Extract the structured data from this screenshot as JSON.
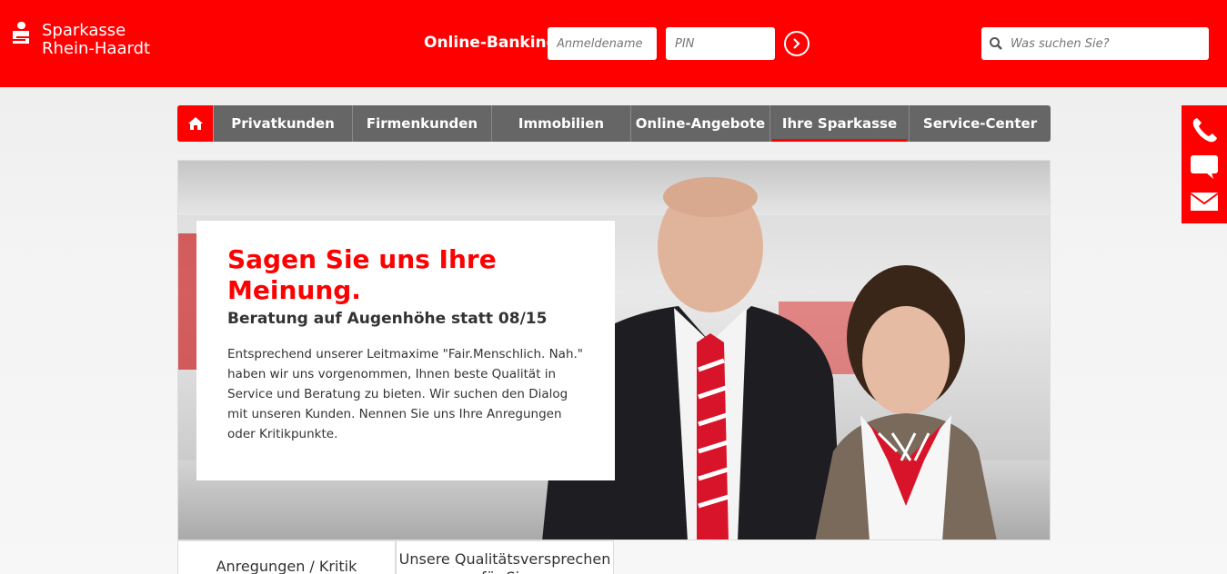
{
  "header": {
    "logo_line1": "Sparkasse",
    "logo_line2": "Rhein-Haardt",
    "online_banking_label": "Online-Banking",
    "username_placeholder": "Anmeldename",
    "pin_placeholder": "PIN",
    "search_placeholder": "Was suchen Sie?"
  },
  "nav": {
    "items": [
      {
        "label": "Privatkunden"
      },
      {
        "label": "Firmenkunden"
      },
      {
        "label": "Immobilien"
      },
      {
        "label": "Online-Angebote"
      },
      {
        "label": "Ihre Sparkasse"
      },
      {
        "label": "Service-Center"
      }
    ],
    "active": "Ihre Sparkasse"
  },
  "side_bar": {
    "icons": [
      "phone-icon",
      "chat-icon",
      "mail-icon"
    ]
  },
  "hero": {
    "title": "Sagen Sie uns Ihre Meinung.",
    "subtitle": "Beratung auf Augenhöhe statt 08/15",
    "body": "Entsprechend unserer Leitmaxime \"Fair.Menschlich. Nah.\" haben wir uns vorgenommen, Ihnen beste Qualität in Service und Beratung zu bieten. Wir suchen den Dialog mit unseren Kunden. Nennen Sie uns Ihre Anregungen oder Kritikpunkte."
  },
  "tabs": [
    {
      "label": "Anregungen / Kritik"
    },
    {
      "label": "Unsere Qualitätsversprechen für Sie"
    }
  ],
  "colors": {
    "brand_red": "#ff0000",
    "nav_gray": "#666666"
  }
}
